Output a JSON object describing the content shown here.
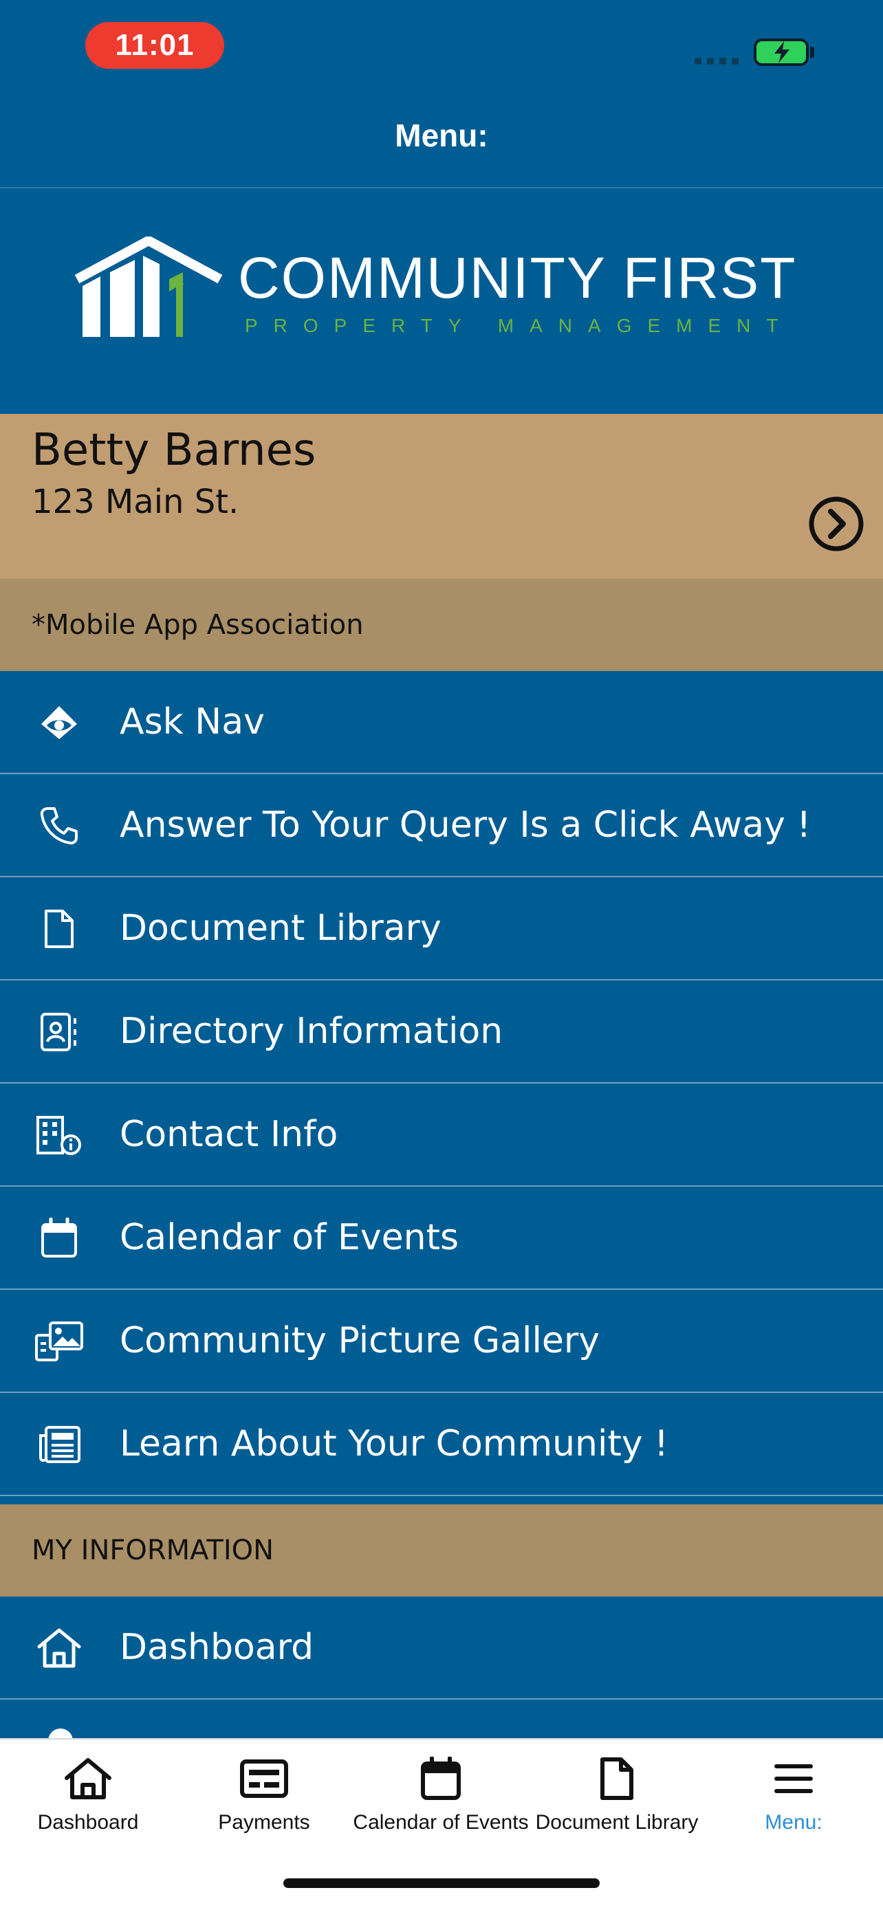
{
  "status_bar": {
    "time": "11:01"
  },
  "header": {
    "title": "Menu:"
  },
  "logo": {
    "title": "COMMUNITY FIRST",
    "subtitle": "PROPERTY MANAGEMENT",
    "colors": {
      "title": "#ffffff",
      "accent": "#6cb33f"
    }
  },
  "profile": {
    "name": "Betty Barnes",
    "address": "123 Main St."
  },
  "association_label": "*Mobile App Association",
  "menu": {
    "items": [
      {
        "label": "Ask Nav",
        "icon": "ask-nav-icon"
      },
      {
        "label": "Answer To Your Query Is a Click Away !",
        "icon": "phone-icon"
      },
      {
        "label": "Document Library",
        "icon": "document-icon"
      },
      {
        "label": "Directory Information",
        "icon": "contact-card-icon"
      },
      {
        "label": "Contact Info",
        "icon": "building-info-icon"
      },
      {
        "label": "Calendar of Events",
        "icon": "calendar-icon"
      },
      {
        "label": "Community Picture Gallery",
        "icon": "gallery-icon"
      },
      {
        "label": "Learn About Your Community !",
        "icon": "newspaper-icon"
      }
    ]
  },
  "my_information": {
    "title": "MY INFORMATION",
    "items": [
      {
        "label": "Dashboard",
        "icon": "home-icon"
      }
    ]
  },
  "tab_bar": {
    "tabs": [
      {
        "label": "Dashboard",
        "icon": "home-icon"
      },
      {
        "label": "Payments",
        "icon": "payments-icon"
      },
      {
        "label": "Calendar of Events",
        "icon": "calendar-icon"
      },
      {
        "label": "Document Library",
        "icon": "document-icon"
      },
      {
        "label": "Menu:",
        "icon": "hamburger-icon",
        "active": true
      }
    ]
  },
  "colors": {
    "primary": "#005d94",
    "profile_bg": "#c19d72",
    "section_bg": "#a88f66",
    "active_tab": "#2b8ed6"
  }
}
